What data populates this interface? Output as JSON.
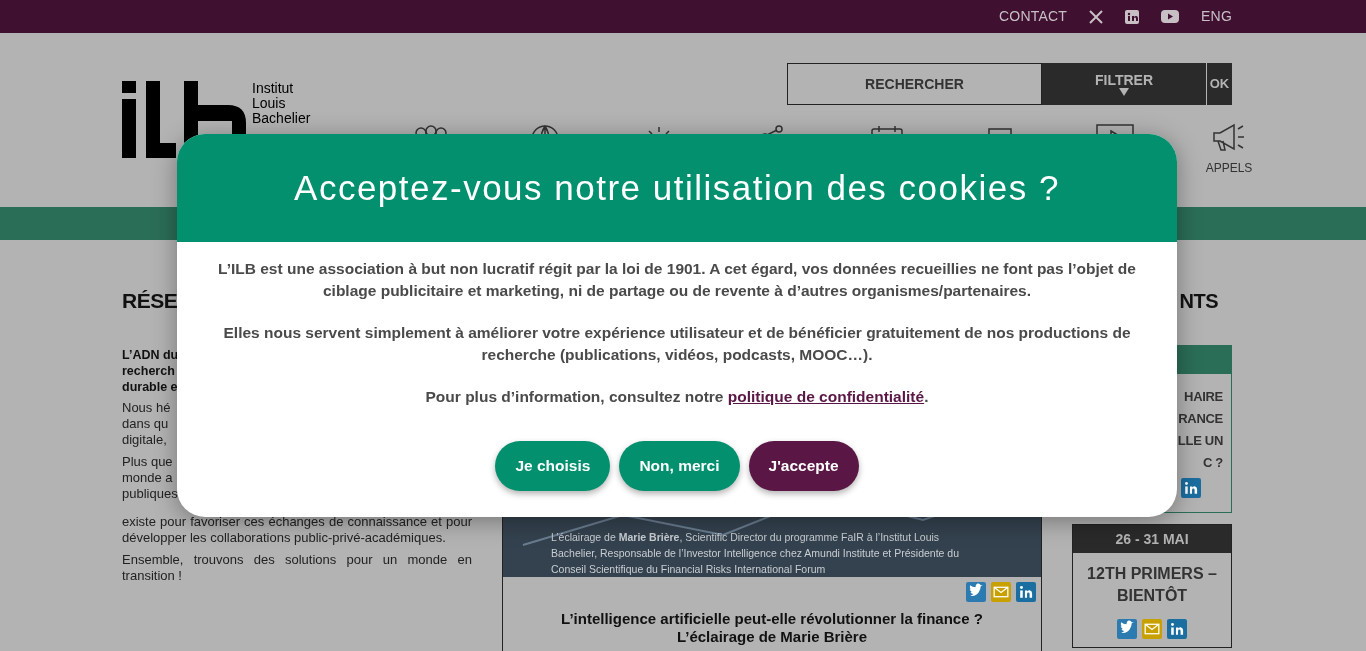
{
  "top_bar": {
    "items": [
      {
        "kind": "text",
        "label": "CONTACT"
      },
      {
        "kind": "x"
      },
      {
        "kind": "linkedin"
      },
      {
        "kind": "youtube"
      },
      {
        "kind": "text",
        "label": "ENG"
      }
    ]
  },
  "logo": {
    "lines": [
      "Institut",
      "Louis",
      "Bachelier"
    ]
  },
  "search": {
    "search_label": "RECHERCHER",
    "filter_label": "FILTRER",
    "ok_label": "OK"
  },
  "nav": [
    {
      "kind": "people"
    },
    {
      "kind": "globe"
    },
    {
      "kind": "bulb"
    },
    {
      "kind": "network"
    },
    {
      "kind": "calendar"
    },
    {
      "kind": "document"
    },
    {
      "kind": "video"
    },
    {
      "kind": "megaphone",
      "label": "APPELS"
    }
  ],
  "left_column": {
    "heading": "RÉSE",
    "intro_lines": [
      "L’ADN du",
      "recherch",
      "durable e"
    ],
    "paragraphs": [
      {
        "lines": [
          "Nous hé",
          "dans qu",
          "digitale,"
        ]
      },
      {
        "lines": [
          "Plus que",
          "monde a",
          "publiques"
        ],
        "rest": "existe pour favoriser ces échanges de connaissance et pour développer les collaborations public-privé-académiques."
      },
      {
        "rest": "Ensemble, trouvons des solutions pour un monde en transition !"
      }
    ]
  },
  "article": {
    "kind": "picture",
    "caption": "L’éclairage de **Marie Brière**, Scientific Director du programme FaIR à l’Institut Louis Bachelier, Responsable de l’Investor Intelligence chez Amundi Institute et Présidente du Conseil Scientifique du Financial Risks International Forum",
    "shares": [
      {
        "kind": "twitter"
      },
      {
        "kind": "mail"
      },
      {
        "kind": "linkedin"
      }
    ],
    "title": "L’intelligence artificielle peut-elle révolutionner la finance ? L’éclairage de Marie Brière"
  },
  "right_column": {
    "heading": "NTS",
    "cards": [
      {
        "kind": "green",
        "title_lines": [
          "HAIRE",
          "RANCE",
          "LLE UN",
          "C ?"
        ],
        "shares": [
          {
            "kind": "linkedin"
          }
        ]
      },
      {
        "kind": "dark",
        "date": "26 - 31 MAI",
        "title_lines": [
          "12TH PRIMERS –",
          "BIENTÔT"
        ],
        "shares": [
          {
            "kind": "twitter"
          },
          {
            "kind": "mail"
          },
          {
            "kind": "linkedin"
          }
        ]
      }
    ]
  },
  "cookie_dialog": {
    "title": "Acceptez-vous notre utilisation des cookies ?",
    "paragraphs": [
      "L’ILB est une association à but non lucratif régit par la loi de 1901. A cet égard, vos données recueillies ne font pas l’objet de ciblage publicitaire et marketing, ni de partage ou de revente à d’autres organismes/partenaires.",
      "Elles nous servent simplement à améliorer votre expérience utilisateur et de bénéficier gratuitement de nos productions de recherche (publications, vidéos, podcasts, MOOC…)."
    ],
    "info": {
      "before": "Pour plus d’information, consultez notre ",
      "link": "politique de confidentialité",
      "after": "."
    },
    "buttons": [
      {
        "label": "Je choisis",
        "kind": "primary"
      },
      {
        "label": "Non, merci",
        "kind": "primary"
      },
      {
        "label": "J'accepte",
        "kind": "accent"
      }
    ]
  }
}
